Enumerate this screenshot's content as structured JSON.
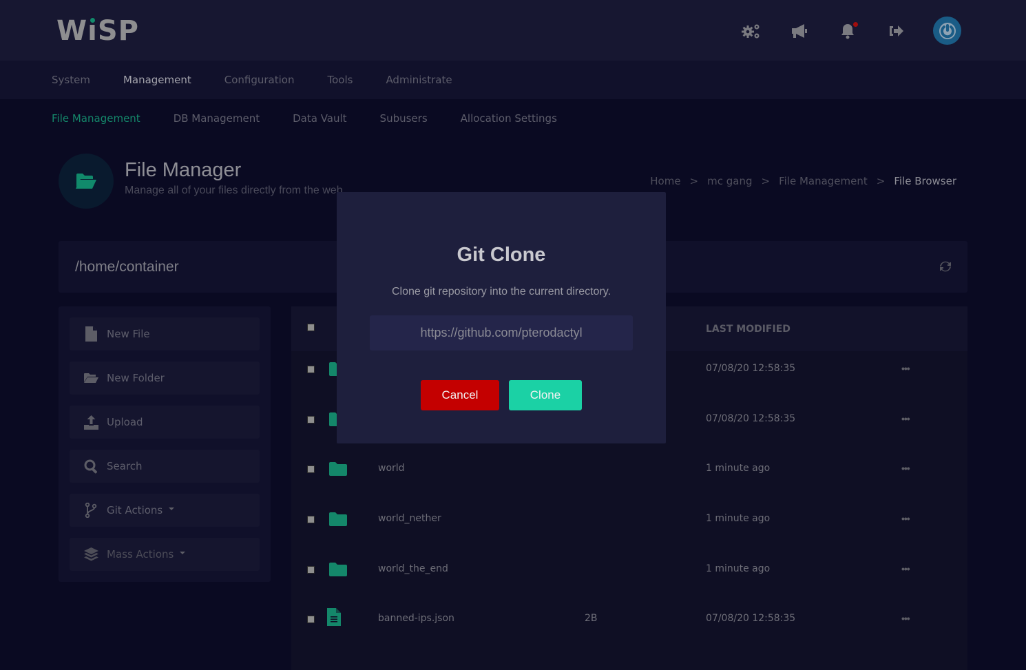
{
  "brand": {
    "logo_text": "WiSP",
    "accent": "#118a6b"
  },
  "topbar": {
    "icons": [
      {
        "name": "settings-gears-icon"
      },
      {
        "name": "megaphone-icon"
      },
      {
        "name": "bell-icon",
        "has_notification": true
      },
      {
        "name": "logout-icon"
      },
      {
        "name": "power-icon"
      }
    ]
  },
  "nav_primary": {
    "items": [
      {
        "label": "System",
        "active": false
      },
      {
        "label": "Management",
        "active": true
      },
      {
        "label": "Configuration",
        "active": false
      },
      {
        "label": "Tools",
        "active": false
      },
      {
        "label": "Administrate",
        "active": false
      }
    ]
  },
  "nav_secondary": {
    "items": [
      {
        "label": "File Management",
        "active": true
      },
      {
        "label": "DB Management",
        "active": false
      },
      {
        "label": "Data Vault",
        "active": false
      },
      {
        "label": "Subusers",
        "active": false
      },
      {
        "label": "Allocation Settings",
        "active": false
      }
    ]
  },
  "page_header": {
    "title": "File Manager",
    "subtitle": "Manage all of your files directly from the web",
    "icon": "folder-open-icon"
  },
  "breadcrumb": {
    "separator": ">",
    "items": [
      "Home",
      "mc gang",
      "File Management",
      "File Browser"
    ]
  },
  "path_bar": {
    "path": "/home/container",
    "refresh_icon": "refresh-icon"
  },
  "sidebar": {
    "buttons": [
      {
        "label": "New File",
        "icon": "file-icon"
      },
      {
        "label": "New Folder",
        "icon": "folder-open-icon"
      },
      {
        "label": "Upload",
        "icon": "upload-icon"
      },
      {
        "label": "Search",
        "icon": "search-icon"
      },
      {
        "label": "Git Actions",
        "icon": "git-branch-icon",
        "dropdown": true
      },
      {
        "label": "Mass Actions",
        "icon": "layers-icon",
        "dropdown": true
      }
    ]
  },
  "file_table": {
    "headers": {
      "modified": "LAST MODIFIED"
    },
    "rows": [
      {
        "type": "folder",
        "name": "",
        "size": "",
        "modified": "07/08/20 12:58:35"
      },
      {
        "type": "folder",
        "name": "",
        "size": "",
        "modified": "07/08/20 12:58:35"
      },
      {
        "type": "folder",
        "name": "world",
        "size": "",
        "modified": "1 minute ago"
      },
      {
        "type": "folder",
        "name": "world_nether",
        "size": "",
        "modified": "1 minute ago"
      },
      {
        "type": "folder",
        "name": "world_the_end",
        "size": "",
        "modified": "1 minute ago"
      },
      {
        "type": "file",
        "name": "banned-ips.json",
        "size": "2B",
        "modified": "07/08/20 12:58:35"
      }
    ],
    "row_menu_label": "•••"
  },
  "modal": {
    "title": "Git Clone",
    "description": "Clone git repository into the current directory.",
    "input_value": "https://github.com/pterodactyl",
    "cancel_label": "Cancel",
    "confirm_label": "Clone",
    "cancel_color": "#c40000",
    "confirm_color": "#1bd1a5"
  }
}
